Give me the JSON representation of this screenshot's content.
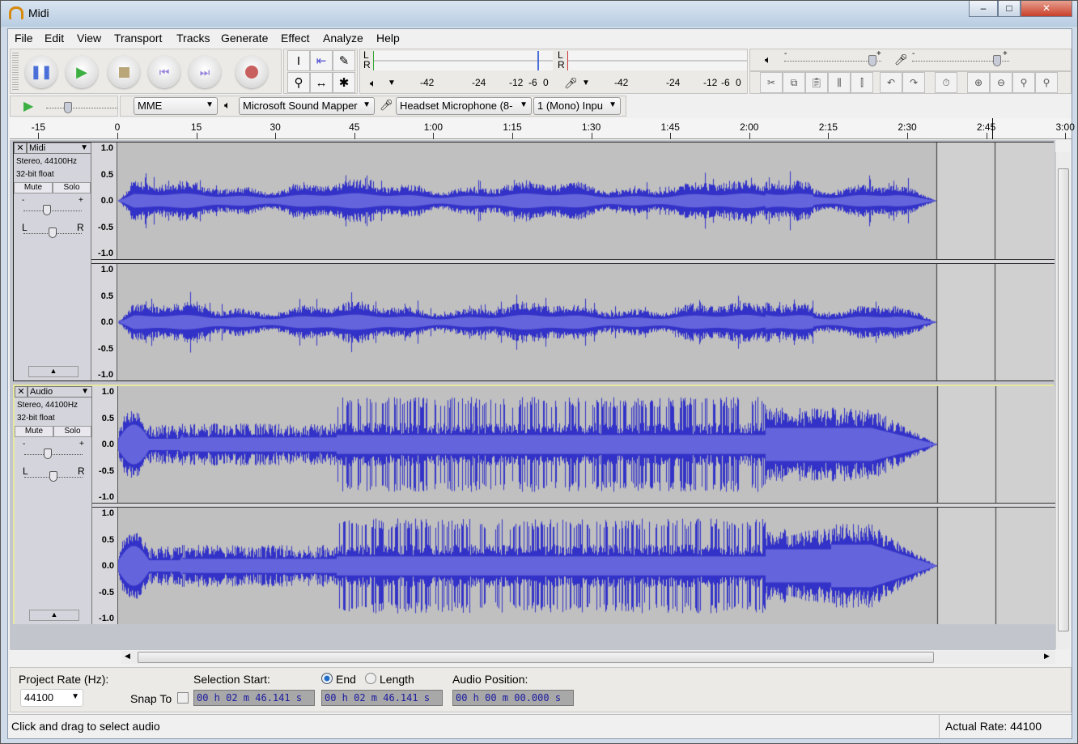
{
  "window": {
    "title": "Midi",
    "minimize": "–",
    "maximize": "□",
    "close": "✕"
  },
  "menu": [
    "File",
    "Edit",
    "View",
    "Transport",
    "Tracks",
    "Generate",
    "Effect",
    "Analyze",
    "Help"
  ],
  "transport": {
    "pause": "pause-icon",
    "play": "play-icon",
    "stop": "stop-icon",
    "skip_start": "skip-start-icon",
    "skip_end": "skip-end-icon",
    "record": "record-icon"
  },
  "tools": [
    "I",
    "⇤",
    "✎",
    "⚲",
    "↔",
    "✱"
  ],
  "meters": {
    "playback": {
      "L": "L",
      "R": "R"
    },
    "record": {
      "L": "L",
      "R": "R"
    },
    "scale": [
      "-42",
      "-24",
      "-12",
      "-6",
      "0"
    ]
  },
  "mixer": {
    "minus": "-",
    "plus": "+"
  },
  "device": {
    "host": "MME",
    "output": "Microsoft Sound Mapper",
    "input": "Headset Microphone (8-",
    "channels": "1 (Mono) Inpu"
  },
  "ruler": {
    "ticks": [
      "-15",
      "0",
      "15",
      "30",
      "45",
      "1:00",
      "1:15",
      "1:30",
      "1:45",
      "2:00",
      "2:15",
      "2:30",
      "2:45",
      "3:00"
    ],
    "tick_seconds": [
      -15,
      0,
      15,
      30,
      45,
      60,
      75,
      90,
      105,
      120,
      135,
      150,
      165,
      180
    ]
  },
  "tracks": [
    {
      "name": "Midi",
      "info1": "Stereo, 44100Hz",
      "info2": "32-bit float",
      "mute": "Mute",
      "solo": "Solo",
      "gain_minus": "-",
      "gain_plus": "+",
      "pan_l": "L",
      "pan_r": "R",
      "selected": false
    },
    {
      "name": "Audio",
      "info1": "Stereo, 44100Hz",
      "info2": "32-bit float",
      "mute": "Mute",
      "solo": "Solo",
      "gain_minus": "-",
      "gain_plus": "+",
      "pan_l": "L",
      "pan_r": "R",
      "selected": true
    }
  ],
  "vruler": [
    "1.0",
    "0.5",
    "0.0",
    "-0.5",
    "-1.0"
  ],
  "selection_bar": {
    "project_rate_label": "Project Rate (Hz):",
    "project_rate": "44100",
    "snap_to": "Snap To",
    "selection_start_label": "Selection Start:",
    "end_label": "End",
    "length_label": "Length",
    "end_selected": true,
    "audio_position_label": "Audio Position:",
    "selection_start": "00 h 02 m 46.141 s",
    "end": "00 h 02 m 46.141 s",
    "audio_position": "00 h 00 m 00.000 s"
  },
  "status": {
    "message": "Click and drag to select audio",
    "actual_rate": "Actual Rate: 44100"
  },
  "colors": {
    "wave_peak": "#3232c8",
    "wave_rms": "#6464dc",
    "track_bg": "#c0c0c0"
  }
}
